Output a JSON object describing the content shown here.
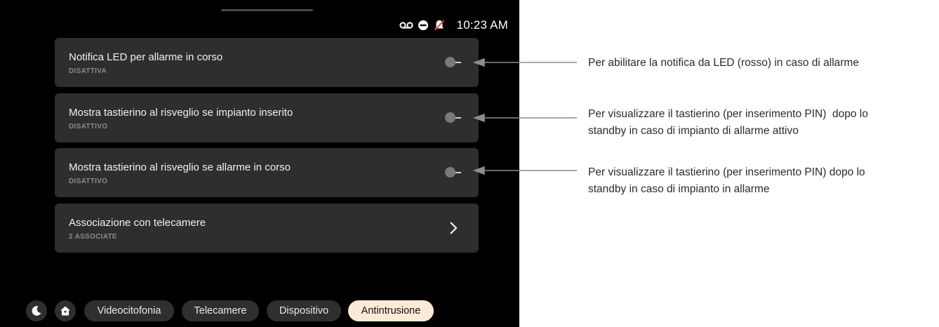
{
  "status": {
    "icons": [
      "voicemail-icon",
      "do-not-disturb-icon",
      "muted-bell-icon"
    ],
    "time": "10:23 AM"
  },
  "settings": [
    {
      "title": "Notifica LED per allarme in corso",
      "subtitle": "DISATTIVA",
      "control": "toggle",
      "enabled": false
    },
    {
      "title": "Mostra tastierino al risveglio se impianto inserito",
      "subtitle": "DISATTIVO",
      "control": "toggle",
      "enabled": false
    },
    {
      "title": "Mostra tastierino al risveglio se allarme in corso",
      "subtitle": "DISATTIVO",
      "control": "toggle",
      "enabled": false
    },
    {
      "title": "Associazione con telecamere",
      "subtitle": "2 ASSOCIATE",
      "control": "chevron"
    }
  ],
  "nav": {
    "icons": [
      "night-mode-icon",
      "home-icon"
    ],
    "tabs": [
      {
        "label": "Videocitofonia",
        "active": false
      },
      {
        "label": "Telecamere",
        "active": false
      },
      {
        "label": "Dispositivo",
        "active": false
      },
      {
        "label": "Antintrusione",
        "active": true
      }
    ]
  },
  "annotations": [
    {
      "lines": [
        "Per abilitare la notifica da LED (rosso) in caso di allarme"
      ]
    },
    {
      "lines": [
        "Per visualizzare il tastierino (per inserimento PIN)  dopo lo",
        "standby in caso di impianto di allarme attivo"
      ]
    },
    {
      "lines": [
        "Per visualizzare il tastierino (per inserimento PIN) dopo lo",
        "standby in caso di impianto in allarme"
      ]
    }
  ],
  "colors": {
    "screen_bg": "#000000",
    "card_bg": "#2e2e2e",
    "active_tab_bg": "#fbead5",
    "toggle_off": "#7a7a7a",
    "annotation_line": "#8c8c8c"
  }
}
